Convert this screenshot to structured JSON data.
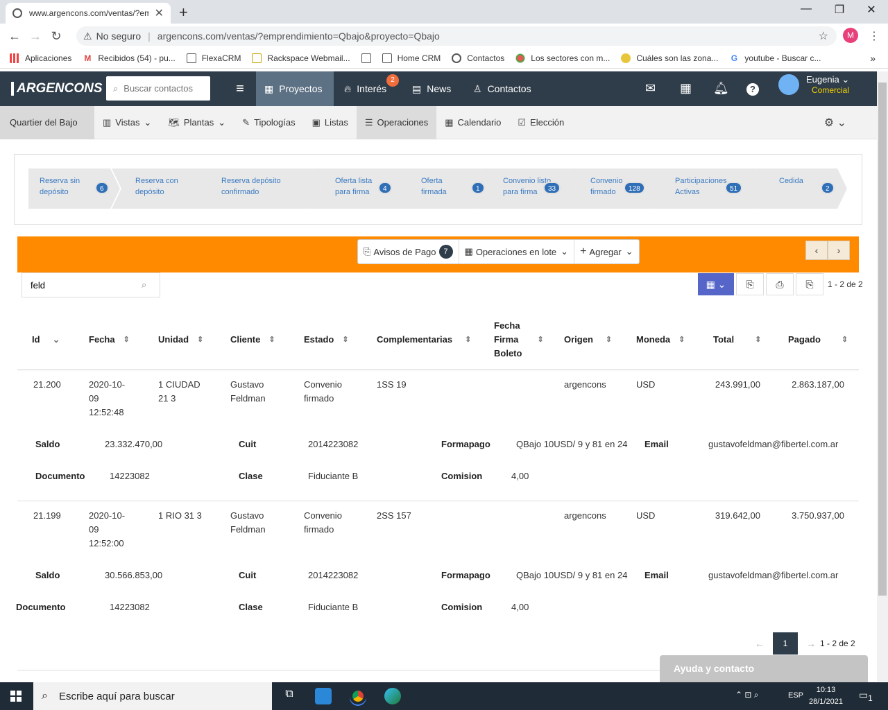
{
  "browser": {
    "tab_title": "www.argencons.com/ventas/?em",
    "security": "No seguro",
    "url": "argencons.com/ventas/?emprendimiento=Qbajo&proyecto=Qbajo",
    "profile_initial": "M",
    "bookmarks": [
      "Aplicaciones",
      "Recibidos (54) - pu...",
      "FlexaCRM",
      "Rackspace Webmail...",
      "",
      "Home CRM",
      "Contactos",
      "Los sectores con m...",
      "Cuáles son las zona...",
      "youtube - Buscar c..."
    ]
  },
  "header": {
    "logo": "ARGENCONS",
    "search_placeholder": "Buscar contactos",
    "nav": {
      "proyectos": "Proyectos",
      "interes": "Interés",
      "interes_badge": "2",
      "news": "News",
      "contactos": "Contactos"
    },
    "user_name": "Eugenia",
    "user_role": "Comercial"
  },
  "subnav": {
    "project": "Quartier del Bajo",
    "items": [
      "Vistas",
      "Plantas",
      "Tipologías",
      "Listas",
      "Operaciones",
      "Calendario",
      "Elección"
    ]
  },
  "stages": [
    {
      "label": "Reserva sin depósito",
      "line1": "Reserva sin",
      "line2": "depósito",
      "count": "6"
    },
    {
      "label": "Reserva con depósito",
      "line1": "Reserva con",
      "line2": "depósito",
      "count": ""
    },
    {
      "label": "Reserva depósito confirmado",
      "line1": "Reserva depósito",
      "line2": "confirmado",
      "count": ""
    },
    {
      "label": "Oferta lista para firma",
      "line1": "Oferta lista",
      "line2": "para firma",
      "count": "4"
    },
    {
      "label": "Oferta firmada",
      "line1": "Oferta",
      "line2": "firmada",
      "count": "1"
    },
    {
      "label": "Convenio listo para firma",
      "line1": "Convenio listo",
      "line2": "para firma",
      "count": "33"
    },
    {
      "label": "Convenio firmado",
      "line1": "Convenio",
      "line2": "firmado",
      "count": "128"
    },
    {
      "label": "Participaciones Activas",
      "line1": "Participaciones",
      "line2": "Activas",
      "count": "51"
    },
    {
      "label": "Cedida",
      "line1": "Cedida",
      "line2": "",
      "count": "2"
    }
  ],
  "toolbar": {
    "avisos": "Avisos de Pago",
    "avisos_count": "7",
    "lote": "Operaciones en lote",
    "agregar": "Agregar"
  },
  "filter": {
    "value": "feld"
  },
  "range": "1 - 2 de 2",
  "columns": {
    "id": "Id",
    "fecha": "Fecha",
    "unidad": "Unidad",
    "cliente": "Cliente",
    "estado": "Estado",
    "complementarias": "Complementarias",
    "ffb1": "Fecha",
    "ffb2": "Firma",
    "ffb3": "Boleto",
    "origen": "Origen",
    "moneda": "Moneda",
    "total": "Total",
    "pagado": "Pagado"
  },
  "detail_labels": {
    "saldo": "Saldo",
    "cuit": "Cuit",
    "formapago": "Formapago",
    "email": "Email",
    "documento": "Documento",
    "clase": "Clase",
    "comision": "Comision"
  },
  "rows": [
    {
      "id": "21.200",
      "fecha1": "2020-10-",
      "fecha2": "09",
      "fecha3": "12:52:48",
      "unidad1": "1 CIUDAD",
      "unidad2": "21 3",
      "cliente1": "Gustavo",
      "cliente2": "Feldman",
      "estado1": "Convenio",
      "estado2": "firmado",
      "complementarias": "1SS 19",
      "origen": "argencons",
      "moneda": "USD",
      "total": "243.991,00",
      "pagado": "2.863.187,00",
      "saldo": "23.332.470,00",
      "cuit": "2014223082",
      "formapago": "QBajo 10USD/ 9 y 81 en 24",
      "email": "gustavofeldman@fibertel.com.ar",
      "documento": "14223082",
      "clase": "Fiduciante B",
      "comision": "4,00"
    },
    {
      "id": "21.199",
      "fecha1": "2020-10-",
      "fecha2": "09",
      "fecha3": "12:52:00",
      "unidad1": "1 RIO 31 3",
      "unidad2": "",
      "cliente1": "Gustavo",
      "cliente2": "Feldman",
      "estado1": "Convenio",
      "estado2": "firmado",
      "complementarias": "2SS 157",
      "origen": "argencons",
      "moneda": "USD",
      "total": "319.642,00",
      "pagado": "3.750.937,00",
      "saldo": "30.566.853,00",
      "cuit": "2014223082",
      "formapago": "QBajo 10USD/ 9 y 81 en 24",
      "email": "gustavofeldman@fibertel.com.ar",
      "documento": "14223082",
      "clase": "Fiduciante B",
      "comision": "4,00"
    }
  ],
  "pagination": {
    "page": "1",
    "range": "1 - 2 de 2"
  },
  "help": "Ayuda y contacto",
  "taskbar": {
    "search": "Escribe aquí para buscar",
    "lang": "ESP",
    "time": "10:13",
    "date": "28/1/2021",
    "notif": "1"
  }
}
